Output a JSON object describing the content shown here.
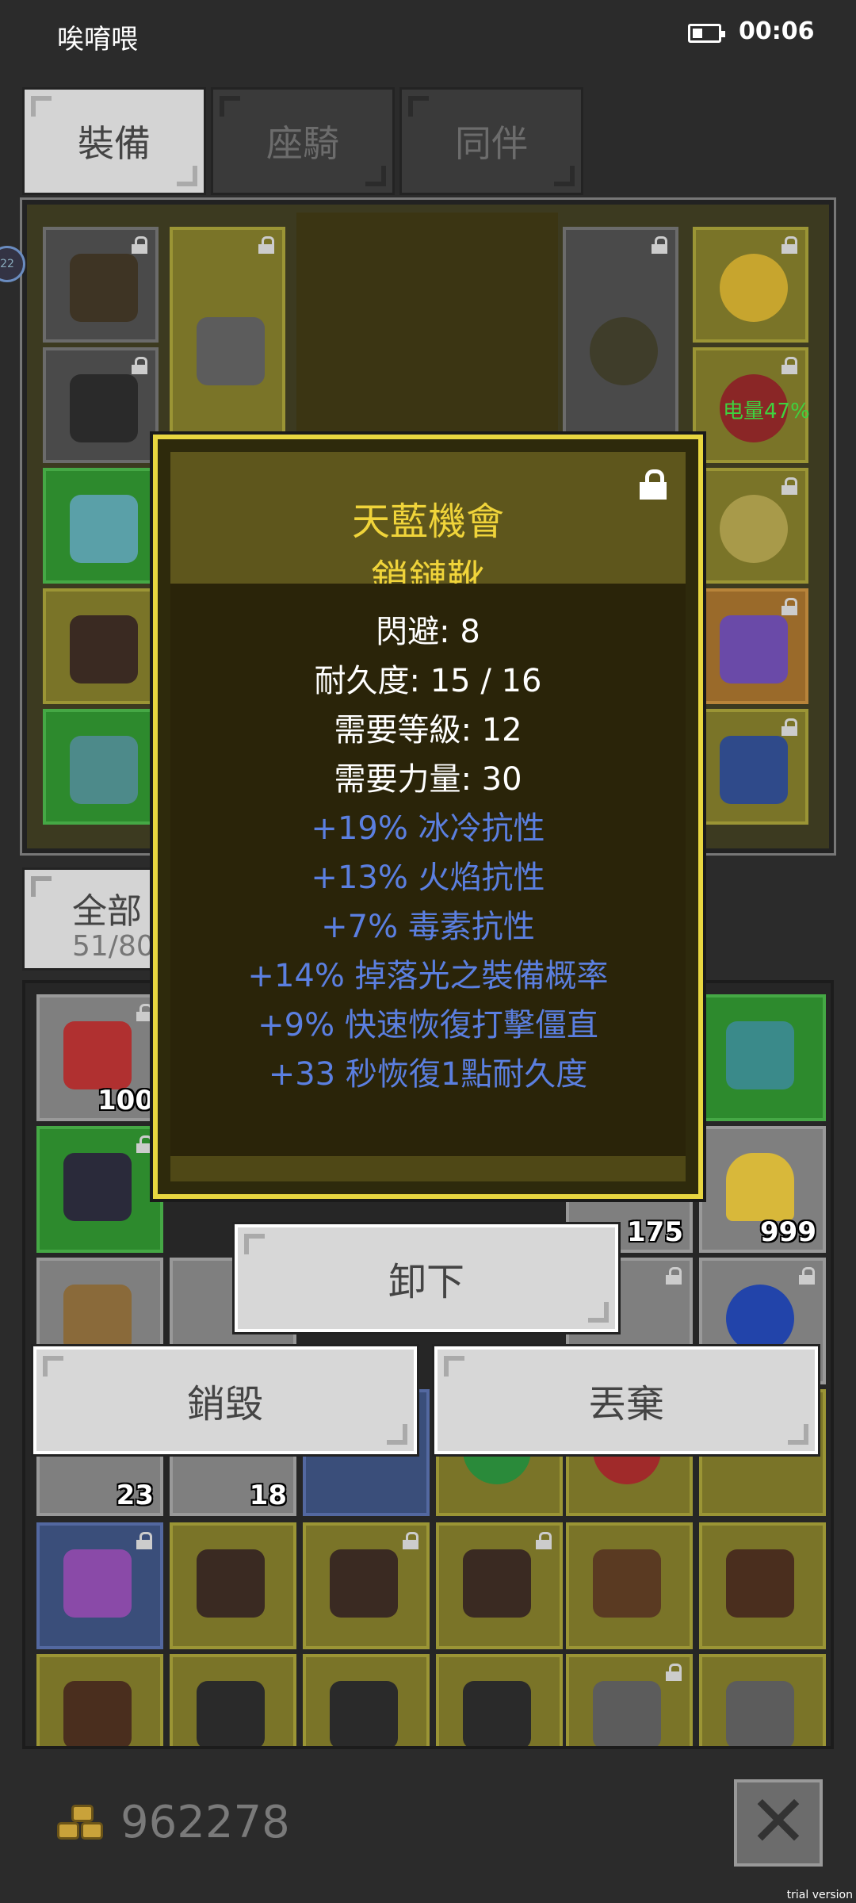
{
  "status_bar": {
    "carrier": "唉唷喂",
    "time": "00:06"
  },
  "tabs": [
    {
      "label": "裝備",
      "active": true
    },
    {
      "label": "座騎",
      "active": false
    },
    {
      "label": "同伴",
      "active": false
    }
  ],
  "equipment": {
    "battery_text": "电量47%",
    "edge_button": "22"
  },
  "inventory": {
    "filter_label": "全部",
    "filter_count": "51/80",
    "counts": [
      "100",
      "175",
      "999",
      "23",
      "18"
    ]
  },
  "tooltip": {
    "rarity": "天藍機會",
    "name": "鎖鏈靴",
    "stats": [
      "閃避: 8",
      "耐久度: 15 / 16",
      "需要等級: 12",
      "需要力量: 30"
    ],
    "affixes": [
      "+19% 冰冷抗性",
      "+13% 火焰抗性",
      "+7% 毒素抗性",
      "+14% 掉落光之裝備概率",
      "+9% 快速恢復打擊僵直",
      "+33 秒恢復1點耐久度"
    ]
  },
  "actions": {
    "unequip": "卸下",
    "destroy": "銷毀",
    "discard": "丟棄"
  },
  "footer": {
    "gold": "962278",
    "close": "✕",
    "watermark": "trial version"
  }
}
